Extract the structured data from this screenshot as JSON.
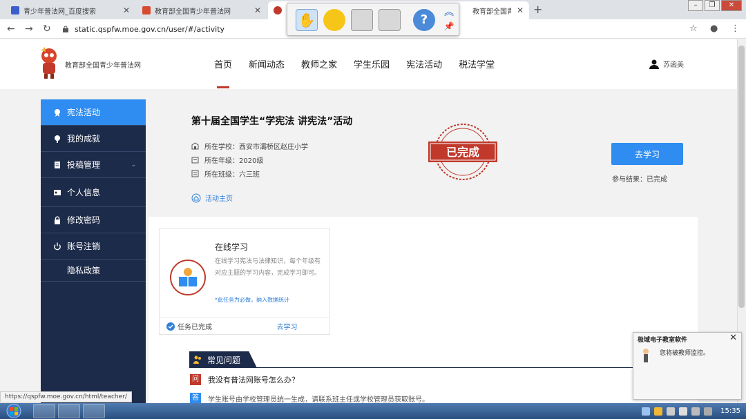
{
  "browser": {
    "tabs": [
      {
        "title": "青少年普法网_百度搜索",
        "close": "✕"
      },
      {
        "title": "教育部全国青少年普法网",
        "close": "✕"
      },
      {
        "title": "教育部全国青少年普法网",
        "close": "✕"
      }
    ],
    "new_tab": "+",
    "url": "static.qspfw.moe.gov.cn/user/#/activity",
    "status_url": "https://qspfw.moe.gov.cn/html/teacher/"
  },
  "site": {
    "logo_text": "教育部全国青少年普法网",
    "nav": [
      "首页",
      "新闻动态",
      "教师之家",
      "学生乐园",
      "宪法活动",
      "税法学堂"
    ],
    "user_name": "苏函美"
  },
  "sidebar": {
    "items": [
      {
        "label": "宪法活动",
        "icon": "star-badge-icon"
      },
      {
        "label": "我的成就",
        "icon": "trophy-icon"
      },
      {
        "label": "投稿管理",
        "icon": "document-icon",
        "caret": "⌄"
      },
      {
        "label": "个人信息",
        "icon": "id-card-icon"
      },
      {
        "label": "修改密码",
        "icon": "lock-icon"
      },
      {
        "label": "账号注销",
        "icon": "power-icon"
      },
      {
        "label": "隐私政策"
      }
    ]
  },
  "activity": {
    "title": "第十届全国学生“学宪法 讲宪法”活动",
    "school": "所在学校：西安市灞桥区赵庄小学",
    "grade": "所在年级：2020级",
    "class": "所在班级：六三班",
    "home_link": "活动主页",
    "stamp": "已完成",
    "go_button": "去学习",
    "result": "参与结果：已完成"
  },
  "card": {
    "title": "在线学习",
    "desc": "在线学习宪法与法律知识，每个年级有对应主题的学习内容，完成学习即可。",
    "note": "*此任务为必做，纳入数据统计",
    "done": "任务已完成",
    "go": "去学习"
  },
  "faq": {
    "title": "常见问题",
    "q_badge": "问",
    "question": "我没有普法网账号怎么办？",
    "a_badge": "答",
    "answer": "学生账号由学校管理员统一生成，请联系班主任或学校管理员获取账号。"
  },
  "notification": {
    "title": "极域电子教室软件",
    "close": "✕",
    "message": "您将被教师监控。"
  },
  "taskbar": {
    "time": "15:35"
  },
  "colors": {
    "accent": "#2f8cf0",
    "sidebar": "#1d2b4a",
    "red": "#c0392b"
  }
}
